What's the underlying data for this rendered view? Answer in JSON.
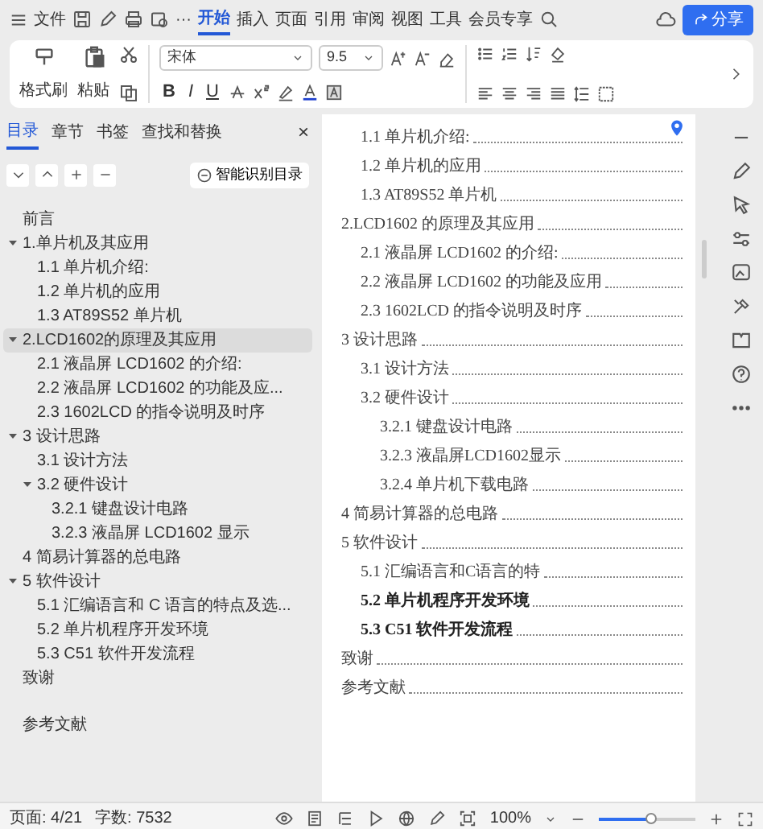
{
  "menu_bar": {
    "file_label": "文件",
    "more": "···",
    "tabs": [
      {
        "label": "开始",
        "selected": true
      },
      {
        "label": "插入",
        "selected": false
      },
      {
        "label": "页面",
        "selected": false
      },
      {
        "label": "引用",
        "selected": false
      },
      {
        "label": "审阅",
        "selected": false
      },
      {
        "label": "视图",
        "selected": false
      },
      {
        "label": "工具",
        "selected": false
      },
      {
        "label": "会员专享",
        "selected": false
      }
    ],
    "share_button": "分享"
  },
  "ribbon": {
    "format_painter": "格式刷",
    "paste": "粘贴",
    "font": "宋体",
    "size": "9.5",
    "bold": "B",
    "italic": "I",
    "underline": "U"
  },
  "sidebar": {
    "tabs": [
      {
        "label": "目录",
        "selected": true
      },
      {
        "label": "章节",
        "selected": false
      },
      {
        "label": "书签",
        "selected": false
      },
      {
        "label": "查找和替换",
        "selected": false
      }
    ],
    "close": "×",
    "smart_button": "智能识别目录",
    "items": [
      {
        "label": "前言",
        "selected": false
      },
      {
        "label": "1.单片机及其应用",
        "selected": false,
        "expanded": true,
        "children": [
          {
            "label": "1.1 单片机介绍:",
            "selected": false
          },
          {
            "label": "1.2 单片机的应用",
            "selected": false
          },
          {
            "label": "1.3 AT89S52 单片机",
            "selected": false
          }
        ]
      },
      {
        "label": "2.LCD1602的原理及其应用",
        "selected": true,
        "expanded": true,
        "children": [
          {
            "label": "2.1 液晶屏 LCD1602 的介绍:",
            "selected": false
          },
          {
            "label": "2.2 液晶屏 LCD1602 的功能及应...",
            "selected": false
          },
          {
            "label": "2.3 1602LCD 的指令说明及时序",
            "selected": false
          }
        ]
      },
      {
        "label": "3 设计思路",
        "selected": false,
        "expanded": true,
        "children": [
          {
            "label": "3.1 设计方法",
            "selected": false
          },
          {
            "label": "3.2 硬件设计",
            "selected": false,
            "expanded": true,
            "children": [
              {
                "label": "3.2.1 键盘设计电路",
                "selected": false
              },
              {
                "label": "3.2.3 液晶屏 LCD1602 显示",
                "selected": false
              }
            ]
          }
        ]
      },
      {
        "label": "4 简易计算器的总电路",
        "selected": false
      },
      {
        "label": "5 软件设计",
        "selected": false,
        "expanded": true,
        "children": [
          {
            "label": "5.1 汇编语言和 C 语言的特点及选...",
            "selected": false
          },
          {
            "label": "5.2 单片机程序开发环境",
            "selected": false
          },
          {
            "label": "5.3 C51 软件开发流程",
            "selected": false
          }
        ]
      },
      {
        "label": "致谢",
        "selected": false
      },
      {
        "label": "参考文献",
        "selected": false
      }
    ]
  },
  "document": {
    "entries": [
      {
        "text": "1.1 单片机介绍:",
        "bold": false
      },
      {
        "text": "1.2 单片机的应用",
        "bold": false
      },
      {
        "text": "1.3 AT89S52 单片机",
        "bold": false
      },
      {
        "text": "2.LCD1602 的原理及其应用",
        "bold": false,
        "children": [
          {
            "text": "2.1 液晶屏 LCD1602 的介绍:",
            "bold": false
          },
          {
            "text": "2.2 液晶屏 LCD1602 的功能及应用",
            "bold": false
          },
          {
            "text": "2.3 1602LCD 的指令说明及时序",
            "bold": false
          }
        ]
      },
      {
        "text": "3 设计思路",
        "bold": false,
        "children": [
          {
            "text": "3.1 设计方法",
            "bold": false
          },
          {
            "text": "3.2 硬件设计",
            "bold": false,
            "children": [
              {
                "text": "3.2.1 键盘设计电路",
                "bold": false
              },
              {
                "text": "3.2.3 液晶屏LCD1602显示",
                "bold": false
              },
              {
                "text": "3.2.4 单片机下载电路",
                "bold": false
              }
            ]
          }
        ]
      },
      {
        "text": "4 简易计算器的总电路",
        "bold": false
      },
      {
        "text": "5 软件设计",
        "bold": false,
        "children": [
          {
            "text": "5.1 汇编语言和C语言的特",
            "bold": false
          },
          {
            "text": "5.2 单片机程序开发环境",
            "bold": true
          },
          {
            "text": "5.3 C51 软件开发流程",
            "bold": true
          }
        ]
      },
      {
        "text": "致谢",
        "bold": false
      },
      {
        "text": "参考文献",
        "bold": false
      }
    ]
  },
  "status_bar": {
    "page": "页面: 4/21",
    "words": "字数: 7532",
    "zoom": "100%",
    "level": 0.55
  }
}
